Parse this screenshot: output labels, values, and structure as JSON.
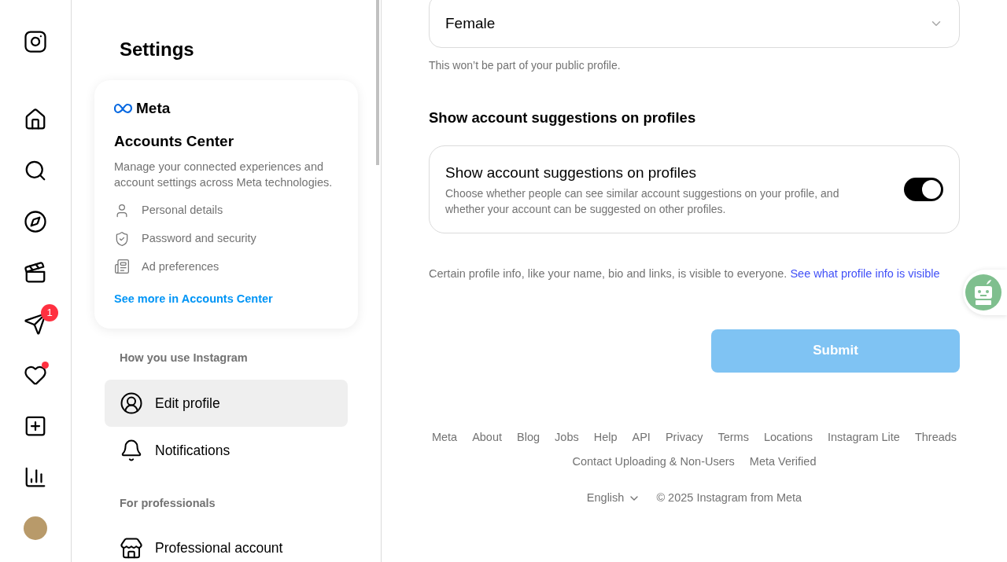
{
  "nav": {
    "messages_badge": "1",
    "activity_dot": true
  },
  "settings": {
    "title": "Settings",
    "accounts_center": {
      "brand": "Meta",
      "title": "Accounts Center",
      "description": "Manage your connected experiences and account settings across Meta technologies.",
      "items": [
        {
          "kind": "person",
          "label": "Personal details"
        },
        {
          "kind": "shield",
          "label": "Password and security"
        },
        {
          "kind": "ad",
          "label": "Ad preferences"
        }
      ],
      "link": "See more in Accounts Center"
    },
    "sections": [
      {
        "heading": "How you use Instagram",
        "items": [
          {
            "kind": "profile",
            "label": "Edit profile",
            "selected": true
          },
          {
            "kind": "bell",
            "label": "Notifications",
            "selected": false
          }
        ]
      },
      {
        "heading": "For professionals",
        "items": [
          {
            "kind": "store",
            "label": "Professional account",
            "selected": false
          }
        ]
      }
    ]
  },
  "main": {
    "gender": {
      "value": "Female",
      "note": "This won’t be part of your public profile."
    },
    "suggestions": {
      "heading": "Show account suggestions on profiles",
      "title": "Show account suggestions on profiles",
      "description": "Choose whether people can see similar account suggestions on your profile, and whether your account can be suggested on other profiles.",
      "on": true
    },
    "visibility_note": "Certain profile info, like your name, bio and links, is visible to everyone.",
    "visibility_link": "See what profile info is visible",
    "submit": {
      "label": "Submit",
      "disabled": true
    }
  },
  "footer": {
    "links": [
      "Meta",
      "About",
      "Blog",
      "Jobs",
      "Help",
      "API",
      "Privacy",
      "Terms",
      "Locations",
      "Instagram Lite",
      "Threads",
      "Contact Uploading & Non-Users",
      "Meta Verified"
    ],
    "language": "English",
    "copyright": "© 2025 Instagram from Meta"
  }
}
